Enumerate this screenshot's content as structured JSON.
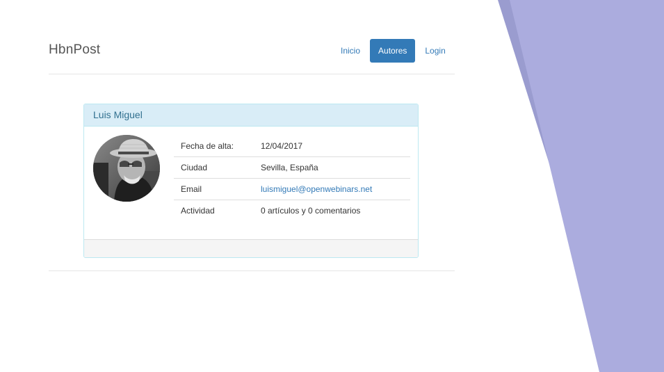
{
  "header": {
    "brand": "HbnPost",
    "nav": [
      {
        "label": "Inicio",
        "active": false
      },
      {
        "label": "Autores",
        "active": true
      },
      {
        "label": "Login",
        "active": false
      }
    ]
  },
  "profile": {
    "name": "Luis Miguel",
    "fields": [
      {
        "label": "Fecha de alta:",
        "value": "12/04/2017",
        "is_link": false
      },
      {
        "label": "Ciudad",
        "value": "Sevilla, España",
        "is_link": false
      },
      {
        "label": "Email",
        "value": "luismiguel@openwebinars.net",
        "is_link": true
      },
      {
        "label": "Actividad",
        "value": "0 artículos y 0 comentarios",
        "is_link": false
      }
    ]
  },
  "colors": {
    "primary": "#337ab7",
    "panel_heading_bg": "#d9edf7",
    "panel_heading_text": "#31708f",
    "panel_border": "#bce8f1",
    "decoration_dark": "#9a9ccf",
    "decoration_light": "#abacde"
  }
}
